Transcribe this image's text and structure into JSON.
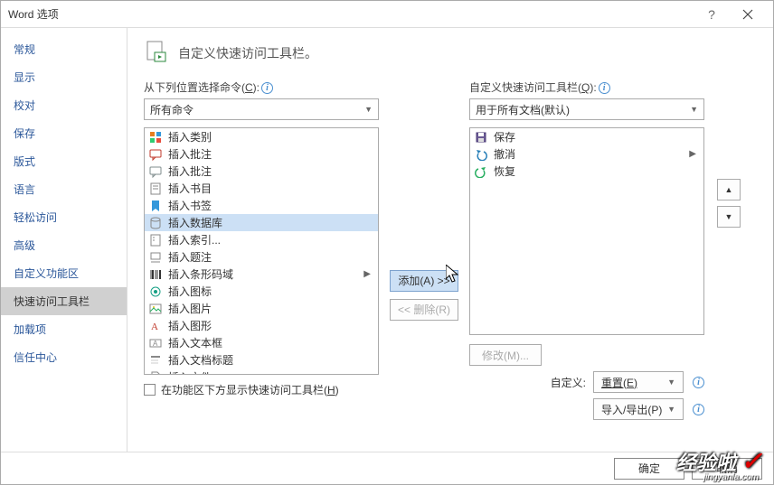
{
  "window": {
    "title": "Word 选项"
  },
  "sidebar": {
    "items": [
      {
        "label": "常规"
      },
      {
        "label": "显示"
      },
      {
        "label": "校对"
      },
      {
        "label": "保存"
      },
      {
        "label": "版式"
      },
      {
        "label": "语言"
      },
      {
        "label": "轻松访问"
      },
      {
        "label": "高级"
      },
      {
        "label": "自定义功能区"
      },
      {
        "label": "快速访问工具栏"
      },
      {
        "label": "加载项"
      },
      {
        "label": "信任中心"
      }
    ],
    "selected_index": 9
  },
  "header": {
    "title": "自定义快速访问工具栏。"
  },
  "left": {
    "label": "从下列位置选择命令(",
    "label_key": "C",
    "label_suffix": "):",
    "select_value": "所有命令",
    "list": [
      {
        "label": "插入类别",
        "icon": "grid-icon"
      },
      {
        "label": "插入批注",
        "icon": "comment-icon"
      },
      {
        "label": "插入批注",
        "icon": "comment2-icon"
      },
      {
        "label": "插入书目",
        "icon": "biblio-icon"
      },
      {
        "label": "插入书签",
        "icon": "bookmark-icon"
      },
      {
        "label": "插入数据库",
        "icon": "database-icon",
        "selected": true
      },
      {
        "label": "插入索引...",
        "icon": "index-icon"
      },
      {
        "label": "插入题注",
        "icon": "caption-icon"
      },
      {
        "label": "插入条形码域",
        "icon": "barcode-icon",
        "submenu": true
      },
      {
        "label": "插入图标",
        "icon": "iconimg-icon"
      },
      {
        "label": "插入图片",
        "icon": "picture-icon"
      },
      {
        "label": "插入图形",
        "icon": "shape-icon"
      },
      {
        "label": "插入文本框",
        "icon": "textbox-icon"
      },
      {
        "label": "插入文档标题",
        "icon": "title-icon"
      },
      {
        "label": "插入文件",
        "icon": "file-icon"
      }
    ],
    "checkbox_label": "在功能区下方显示快速访问工具栏(",
    "checkbox_key": "H",
    "checkbox_suffix": ")"
  },
  "mid": {
    "add_label": "添加(A) >>",
    "remove_label": "<< 删除(R)"
  },
  "right": {
    "label": "自定义快速访问工具栏(",
    "label_key": "Q",
    "label_suffix": "):",
    "select_value": "用于所有文档(默认)",
    "list": [
      {
        "label": "保存",
        "icon": "save-icon"
      },
      {
        "label": "撤消",
        "icon": "undo-icon",
        "submenu": true
      },
      {
        "label": "恢复",
        "icon": "redo-icon"
      }
    ],
    "modify_label": "修改(M)...",
    "customize_label": "自定义:",
    "reset_label": "重置(E)",
    "importexport_label": "导入/导出(P)"
  },
  "footer": {
    "ok": "确定",
    "cancel": "取消"
  },
  "watermark": {
    "main": "经验啦",
    "sub": "jingyanla.com"
  }
}
